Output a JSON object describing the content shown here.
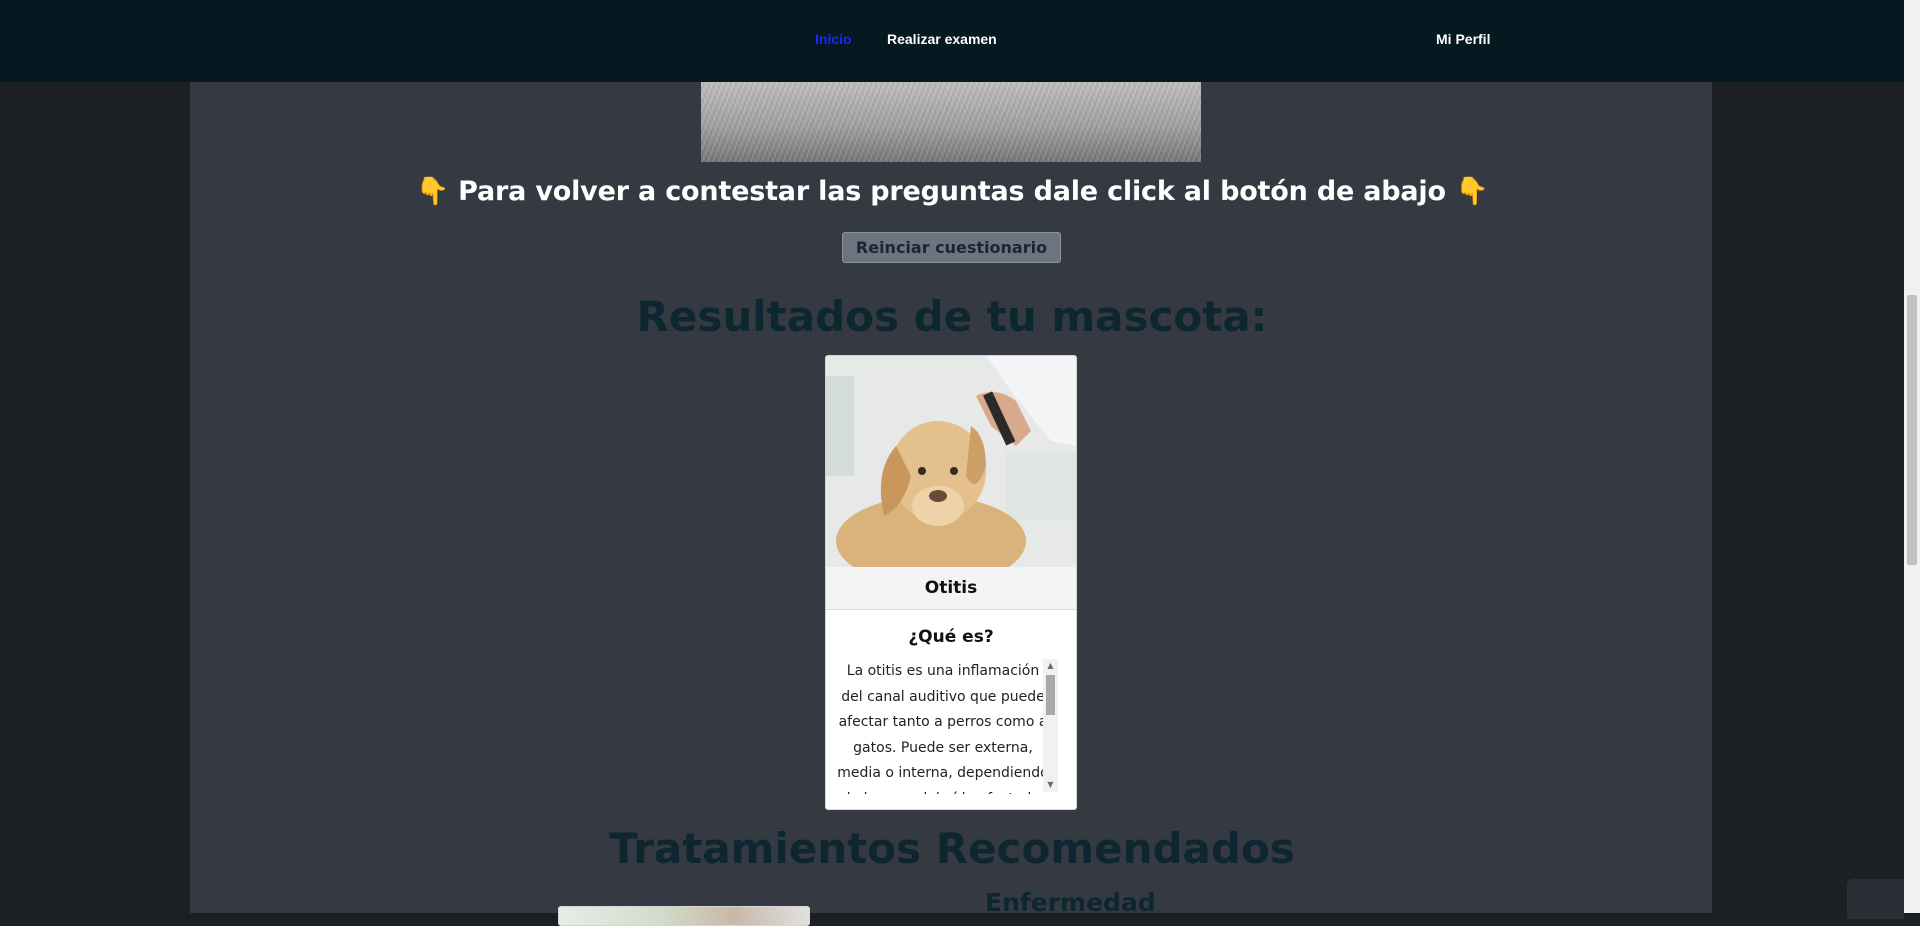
{
  "nav": {
    "home": "Inicio",
    "exam": "Realizar examen",
    "profile": "Mi Perfil",
    "active_color": "#1f24ff"
  },
  "main": {
    "instruction": "Para volver a contestar las preguntas dale click al botón de abajo",
    "instruction_icon": "👇",
    "restart_button": "Reinciar cuestionario",
    "results_title": "Resultados de tu mascota:",
    "treatments_title": "Tratamientos Recomendados"
  },
  "result_card": {
    "image_icon": "dog-ear-exam-photo",
    "disease": "Otitis",
    "what_is_label": "¿Qué es?",
    "description": "La otitis es una inflamación del canal auditivo que puede afectar tanto a perros como a gatos. Puede ser externa, media o interna, dependiendo de la zona del oído afectada."
  },
  "treatment": {
    "disease_label": "Enfermedad"
  },
  "colors": {
    "navbar": "#061820",
    "content_bg": "#353a42",
    "title_color": "#0e2630",
    "button_bg": "#6b7480"
  }
}
